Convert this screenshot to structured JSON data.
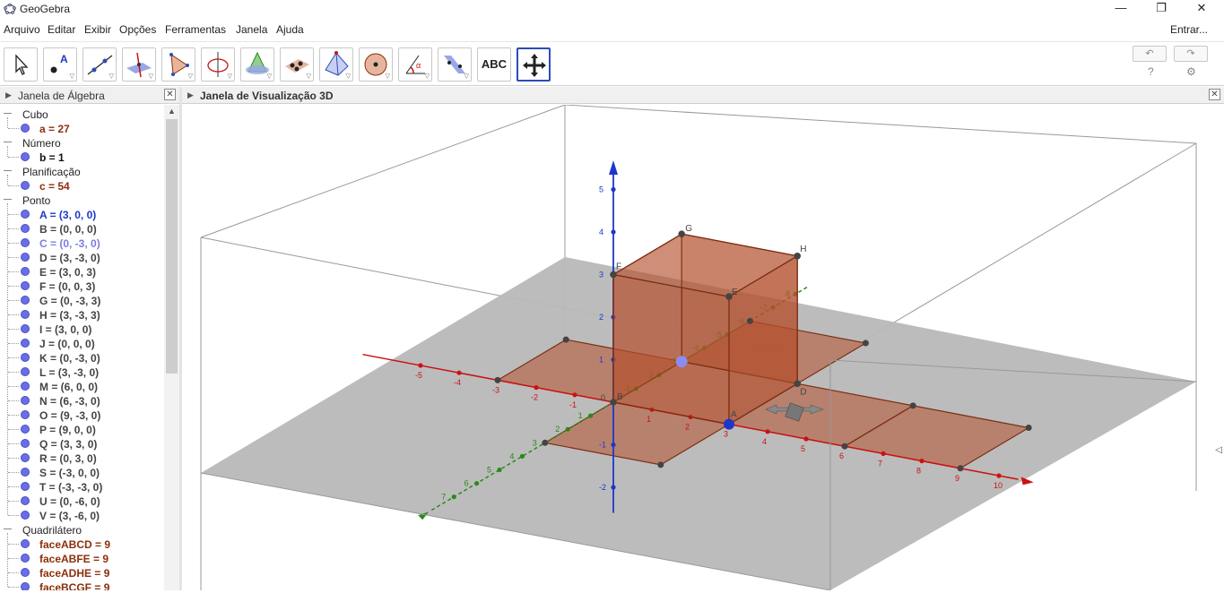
{
  "window": {
    "title": "GeoGebra",
    "minimize": "—",
    "maximize": "❐",
    "close": "✕"
  },
  "menu": {
    "items": [
      "Arquivo",
      "Editar",
      "Exibir",
      "Opções",
      "Ferramentas",
      "Janela",
      "Ajuda"
    ],
    "login": "Entrar..."
  },
  "toolbar": {
    "tools": [
      {
        "name": "move-tool-icon"
      },
      {
        "name": "point-tool-icon"
      },
      {
        "name": "line-tool-icon"
      },
      {
        "name": "perpendicular-line-tool-icon"
      },
      {
        "name": "polygon-tool-icon"
      },
      {
        "name": "circle-axis-tool-icon"
      },
      {
        "name": "intersect-surfaces-tool-icon"
      },
      {
        "name": "plane-through-points-tool-icon"
      },
      {
        "name": "pyramid-tool-icon"
      },
      {
        "name": "sphere-tool-icon"
      },
      {
        "name": "angle-tool-icon"
      },
      {
        "name": "reflect-tool-icon"
      },
      {
        "name": "text-tool-icon",
        "label": "ABC"
      },
      {
        "name": "move-graphics-view-tool-icon",
        "active": true
      }
    ],
    "undo": "↶",
    "redo": "↷",
    "help": "?",
    "settings": "⚙"
  },
  "algebra": {
    "title": "Janela de Álgebra",
    "groups": [
      {
        "label": "Cubo",
        "items": [
          {
            "text": "a = 27",
            "color": "#8b2f0b"
          }
        ]
      },
      {
        "label": "Número",
        "items": [
          {
            "text": "b = 1",
            "color": "#111111"
          }
        ]
      },
      {
        "label": "Planificação",
        "items": [
          {
            "text": "c = 54",
            "color": "#8b2f0b"
          }
        ]
      },
      {
        "label": "Ponto",
        "items": [
          {
            "text": "A = (3, 0, 0)",
            "color": "#1d37c9"
          },
          {
            "text": "B = (0, 0, 0)",
            "color": "#444444"
          },
          {
            "text": "C = (0, -3, 0)",
            "color": "#7d7de0"
          },
          {
            "text": "D = (3, -3, 0)",
            "color": "#444444"
          },
          {
            "text": "E = (3, 0, 3)",
            "color": "#444444"
          },
          {
            "text": "F = (0, 0, 3)",
            "color": "#444444"
          },
          {
            "text": "G = (0, -3, 3)",
            "color": "#444444"
          },
          {
            "text": "H = (3, -3, 3)",
            "color": "#444444"
          },
          {
            "text": "I = (3, 0, 0)",
            "color": "#444444"
          },
          {
            "text": "J = (0, 0, 0)",
            "color": "#444444"
          },
          {
            "text": "K = (0, -3, 0)",
            "color": "#444444"
          },
          {
            "text": "L = (3, -3, 0)",
            "color": "#444444"
          },
          {
            "text": "M = (6, 0, 0)",
            "color": "#444444"
          },
          {
            "text": "N = (6, -3, 0)",
            "color": "#444444"
          },
          {
            "text": "O = (9, -3, 0)",
            "color": "#444444"
          },
          {
            "text": "P = (9, 0, 0)",
            "color": "#444444"
          },
          {
            "text": "Q = (3, 3, 0)",
            "color": "#444444"
          },
          {
            "text": "R = (0, 3, 0)",
            "color": "#444444"
          },
          {
            "text": "S = (-3, 0, 0)",
            "color": "#444444"
          },
          {
            "text": "T = (-3, -3, 0)",
            "color": "#444444"
          },
          {
            "text": "U = (0, -6, 0)",
            "color": "#444444"
          },
          {
            "text": "V = (3, -6, 0)",
            "color": "#444444"
          }
        ]
      },
      {
        "label": "Quadrilátero",
        "items": [
          {
            "text": "faceABCD = 9",
            "color": "#8b2f0b"
          },
          {
            "text": "faceABFE = 9",
            "color": "#8b2f0b"
          },
          {
            "text": "faceADHE = 9",
            "color": "#8b2f0b"
          },
          {
            "text": "faceBCGF = 9",
            "color": "#8b2f0b"
          }
        ]
      }
    ]
  },
  "view3d": {
    "title": "Janela de Visualização 3D",
    "colors": {
      "x_axis": "#cc1111",
      "y_axis": "#2a8a1a",
      "z_axis": "#1d37c9",
      "face": "#b5502d",
      "plane": "#b8b8b8"
    },
    "x_ticks": [
      "-5",
      "-4",
      "-3",
      "-2",
      "-1",
      "1",
      "2",
      "3",
      "4",
      "5",
      "6",
      "7",
      "8",
      "9",
      "10"
    ],
    "y_ticks": [
      "-8",
      "-7",
      "-6",
      "-5",
      "-4",
      "-3",
      "-2",
      "-1",
      "1",
      "2",
      "3",
      "4",
      "5",
      "6",
      "7"
    ],
    "z_ticks": [
      "-2",
      "-1",
      "1",
      "2",
      "3",
      "4",
      "5"
    ],
    "point_labels": [
      "A",
      "B",
      "D",
      "E",
      "F",
      "G",
      "H"
    ],
    "origin_label": "0"
  }
}
